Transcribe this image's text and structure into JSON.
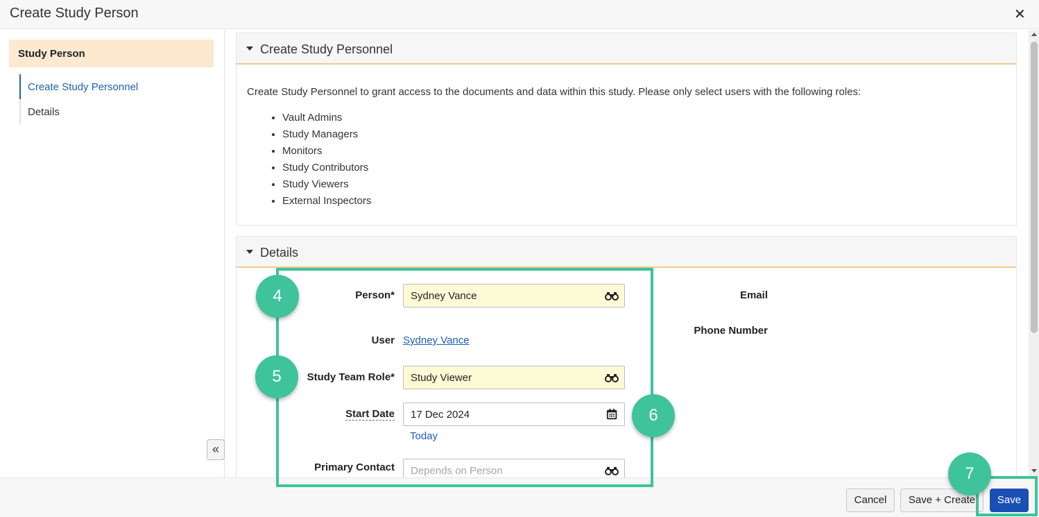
{
  "dialog": {
    "title": "Create Study Person",
    "close_glyph": "✕"
  },
  "sidebar": {
    "header": "Study Person",
    "items": [
      {
        "label": "Create Study Personnel",
        "active": true
      },
      {
        "label": "Details",
        "active": false
      }
    ],
    "collapse_glyph": "«"
  },
  "sections": {
    "create": {
      "title": "Create Study Personnel",
      "intro": "Create Study Personnel to grant access to the documents and data within this study. Please only select users with the following roles:",
      "roles": [
        "Vault Admins",
        "Study Managers",
        "Monitors",
        "Study Contributors",
        "Study Viewers",
        "External Inspectors"
      ]
    },
    "details": {
      "title": "Details",
      "person_label": "Person*",
      "person_value": "Sydney Vance",
      "user_label": "User",
      "user_value": "Sydney Vance",
      "role_label": "Study Team Role*",
      "role_value": "Study Viewer",
      "start_date_label": "Start Date",
      "start_date_value": "17 Dec 2024",
      "today_link": "Today",
      "primary_contact_label": "Primary Contact",
      "primary_contact_placeholder": "Depends on Person",
      "email_label": "Email",
      "phone_label": "Phone Number"
    }
  },
  "footer": {
    "cancel": "Cancel",
    "save_create": "Save + Create",
    "save": "Save"
  },
  "callouts": {
    "step4": "4",
    "step5": "5",
    "step6": "6",
    "step7": "7"
  },
  "colors": {
    "accent": "#3ec39a",
    "primary": "#1a50b5",
    "link": "#1f5fb4",
    "required_bg": "#fdfbd6",
    "section_rule": "#f3c98b"
  },
  "icons": {
    "lookup": "binoculars-icon",
    "date": "calendar-icon"
  }
}
